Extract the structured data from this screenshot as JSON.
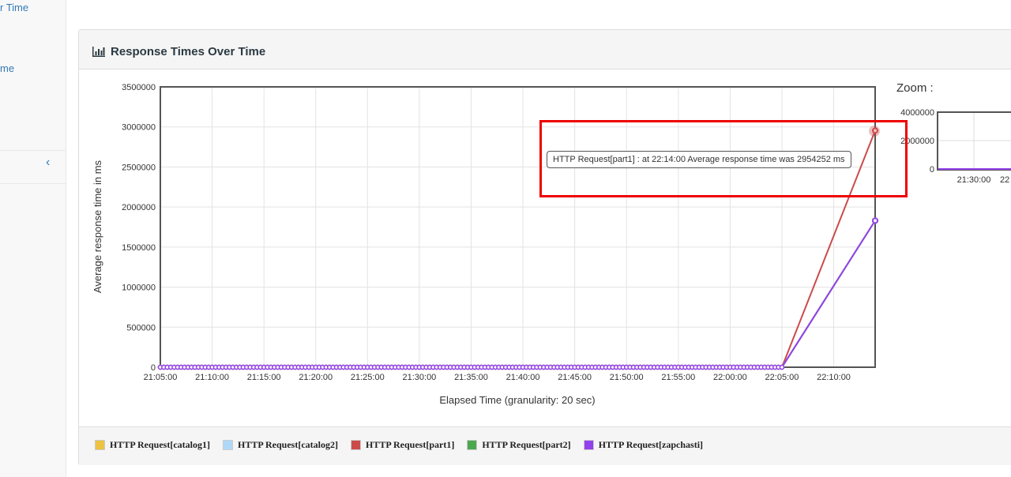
{
  "sidebar": {
    "link1": "r Time",
    "link2": "me",
    "collapse": "‹"
  },
  "panel": {
    "title": "Response Times Over Time"
  },
  "zoom": {
    "label": "Zoom :",
    "yticks": [
      "4000000",
      "2000000",
      "0"
    ],
    "xticks": [
      "21:30:00",
      "22"
    ]
  },
  "tooltip": "HTTP Request[part1] : at 22:14:00 Average response time was 2954252 ms",
  "chart_data": {
    "type": "line",
    "title": "Response Times Over Time",
    "xlabel": "Elapsed Time (granularity: 20 sec)",
    "ylabel": "Average response time in ms",
    "ylim": [
      0,
      3500000
    ],
    "xlim": [
      "21:05:00",
      "22:14:00"
    ],
    "yticks": [
      "0",
      "500000",
      "1000000",
      "1500000",
      "2000000",
      "2500000",
      "3000000",
      "3500000"
    ],
    "xticks": [
      "21:05:00",
      "21:10:00",
      "21:15:00",
      "21:20:00",
      "21:25:00",
      "21:30:00",
      "21:35:00",
      "21:40:00",
      "21:45:00",
      "21:50:00",
      "21:55:00",
      "22:00:00",
      "22:05:00",
      "22:10:00"
    ],
    "grid": true,
    "legend_position": "bottom",
    "series": [
      {
        "name": "HTTP Request[catalog1]",
        "color": "#edc240",
        "points": [
          [
            "21:05:00",
            0
          ],
          [
            "22:05:00",
            0
          ],
          [
            "22:14:00",
            1830000
          ]
        ]
      },
      {
        "name": "HTTP Request[catalog2]",
        "color": "#afd8f8",
        "points": [
          [
            "21:05:00",
            0
          ],
          [
            "22:05:00",
            0
          ],
          [
            "22:14:00",
            1830000
          ]
        ]
      },
      {
        "name": "HTTP Request[part1]",
        "color": "#cb4b4b",
        "points": [
          [
            "21:05:00",
            0
          ],
          [
            "22:05:00",
            0
          ],
          [
            "22:14:00",
            2954252
          ]
        ]
      },
      {
        "name": "HTTP Request[part2]",
        "color": "#4da74d",
        "points": [
          [
            "21:05:00",
            0
          ],
          [
            "22:05:00",
            0
          ],
          [
            "22:14:00",
            1830000
          ]
        ]
      },
      {
        "name": "HTTP Request[zapchasti]",
        "color": "#9440ed",
        "points": [
          [
            "21:05:00",
            0
          ],
          [
            "22:05:00",
            0
          ],
          [
            "22:14:00",
            1830000
          ]
        ]
      }
    ]
  }
}
